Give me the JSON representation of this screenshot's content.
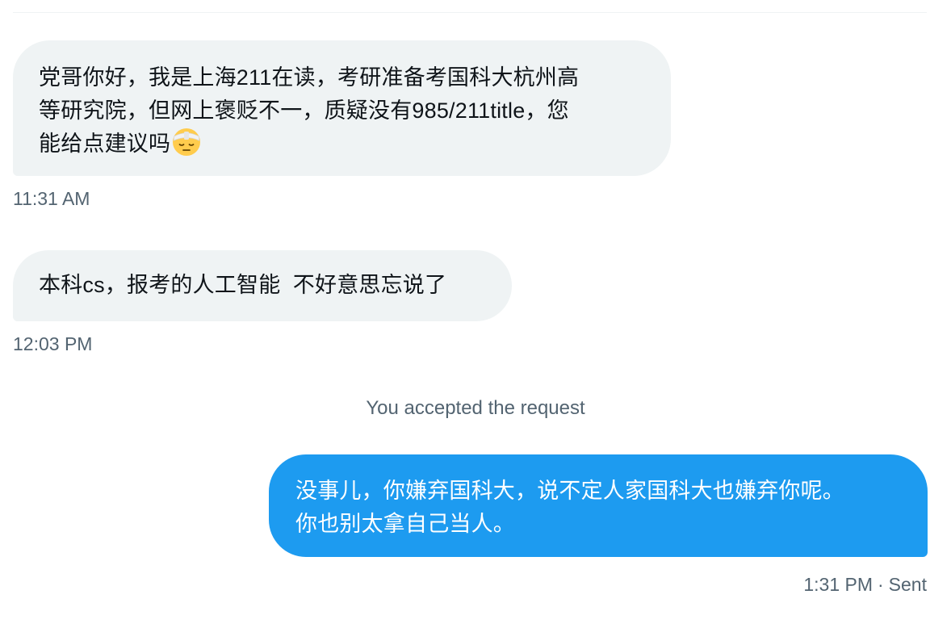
{
  "conversation": {
    "messages": [
      {
        "direction": "received",
        "lines": [
          "党哥你好，我是上海211在读，考研准备考国科大杭州高",
          "等研究院，但网上褒贬不一，质疑没有985/211title，您",
          "能给点建议吗"
        ],
        "emoji": "face-with-head-bandage-icon",
        "time": "11:31 AM"
      },
      {
        "direction": "received",
        "lines": [
          "本科cs，报考的人工智能  不好意思忘说了"
        ],
        "time": "12:03 PM"
      },
      {
        "direction": "sent",
        "lines": [
          "没事儿，你嫌弃国科大，说不定人家国科大也嫌弃你呢。",
          "你也别太拿自己当人。"
        ],
        "time": "1:31 PM",
        "status": "Sent",
        "separator": "·"
      }
    ],
    "system_notice": "You accepted the request"
  },
  "colors": {
    "received_bubble": "#eff3f4",
    "sent_bubble": "#1d9bf0",
    "meta_text": "#536471",
    "body_text": "#0f1419"
  }
}
